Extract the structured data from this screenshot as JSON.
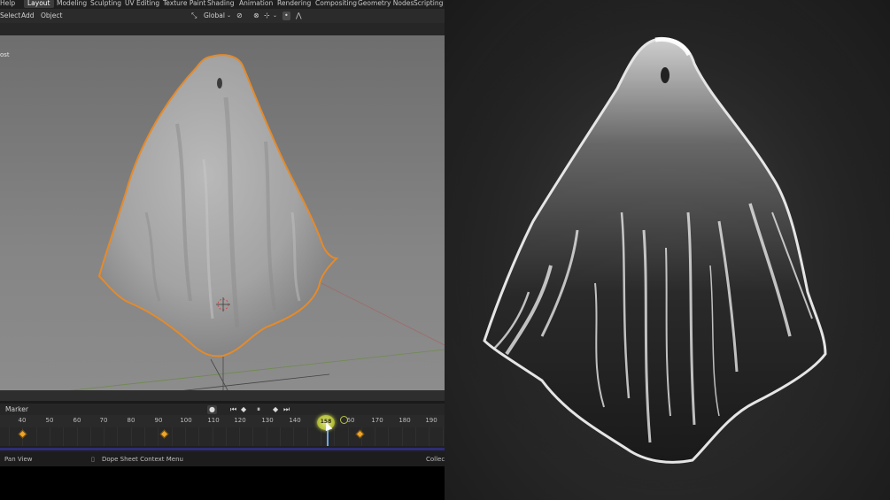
{
  "menu": {
    "help": "Help",
    "workspaces": [
      "Layout",
      "Modeling",
      "Sculpting",
      "UV Editing",
      "Texture Paint",
      "Shading",
      "Animation",
      "Rendering",
      "Compositing",
      "Geometry Nodes",
      "Scripting"
    ],
    "active_workspace": "Layout"
  },
  "viewport_header": {
    "menus": [
      "Select",
      "Add",
      "Object"
    ],
    "transform_orientation": "Global"
  },
  "viewport": {
    "object_label": "ost"
  },
  "timeline": {
    "menu_label": "Marker",
    "current_frame": "158",
    "ruler_ticks": [
      "40",
      "50",
      "60",
      "70",
      "80",
      "90",
      "100",
      "110",
      "120",
      "130",
      "140",
      "60",
      "170",
      "180",
      "190"
    ],
    "keyframes": [
      40,
      92,
      161
    ]
  },
  "status_bar": {
    "pan_view": "Pan View",
    "context_menu": "Dope Sheet Context Menu",
    "collection": "Collect"
  },
  "colors": {
    "accent_blue": "#4a7dbd",
    "selection_orange": "#e58a2a",
    "keyframe": "#f0a52a",
    "playhead": "#b7c23c"
  }
}
